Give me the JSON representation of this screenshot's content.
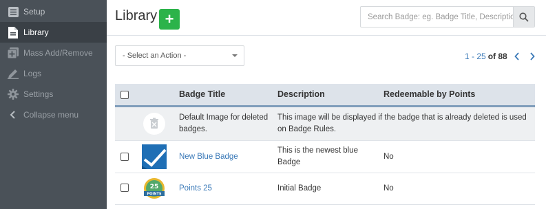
{
  "sidebar": {
    "items": [
      {
        "label": "Setup",
        "icon": "list-icon"
      },
      {
        "label": "Library",
        "icon": "document-icon"
      },
      {
        "label": "Mass Add/Remove",
        "icon": "plus-square-icon"
      },
      {
        "label": "Logs",
        "icon": "pencil-icon"
      },
      {
        "label": "Settings",
        "icon": "gear-icon"
      },
      {
        "label": "Collapse menu",
        "icon": "chevron-left-icon"
      }
    ]
  },
  "header": {
    "title": "Library",
    "add_label": "+",
    "search_placeholder": "Search Badge: eg. Badge Title, Description"
  },
  "toolbar": {
    "action_select": "- Select an Action -"
  },
  "pagination": {
    "range": "1 - 25",
    "of_label": "of 88"
  },
  "table": {
    "columns": [
      "Badge Title",
      "Description",
      "Redeemable by Points"
    ],
    "rows": [
      {
        "title": "Default Image for deleted badges.",
        "description": "This image will be displayed if the badge that is already deleted is used on Badge Rules.",
        "redeemable": "",
        "image": "trash-icon",
        "selectable": false
      },
      {
        "title": "New Blue Badge",
        "description": "This is the newest blue Badge",
        "redeemable": "No",
        "image": "blue-check-badge",
        "selectable": true
      },
      {
        "title": "Points 25",
        "description": "Initial Badge",
        "redeemable": "No",
        "image": "points-25-badge",
        "selectable": true
      }
    ],
    "points_badge_text": "25",
    "points_badge_ribbon": "POINTS"
  },
  "colors": {
    "sidebar_bg": "#4a5158",
    "sidebar_active": "#3a4046",
    "accent_green": "#2cb34a",
    "link_blue": "#3b7ab8",
    "header_row": "#dde3ea"
  }
}
